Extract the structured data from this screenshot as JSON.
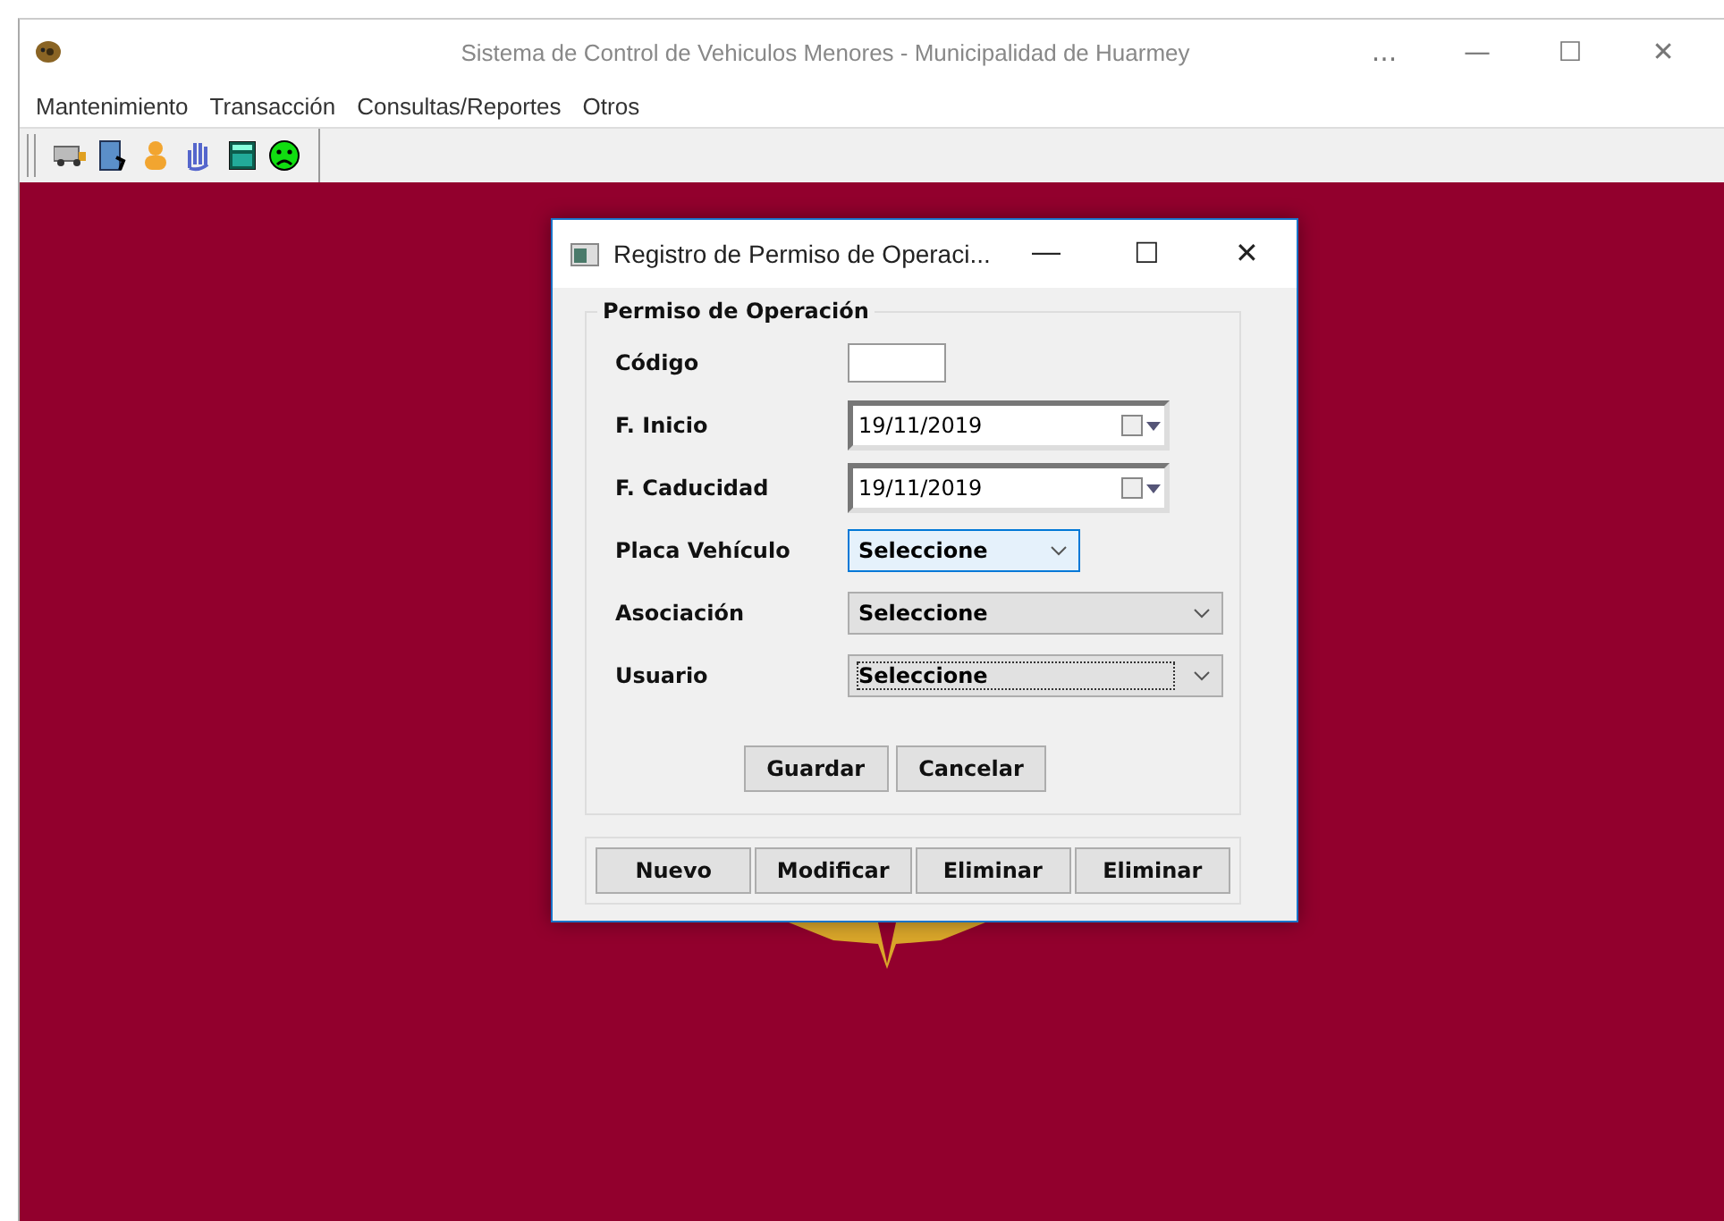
{
  "window": {
    "title": "Sistema de Control de Vehiculos Menores - Municipalidad de Huarmey",
    "controls": [
      "...",
      "—",
      "☐",
      "✕"
    ]
  },
  "menu": [
    "Mantenimiento",
    "Transacción",
    "Consultas/Reportes",
    "Otros"
  ],
  "toolbar": [
    {
      "kind": "bus"
    },
    {
      "kind": "exit"
    },
    {
      "kind": "user"
    },
    {
      "kind": "hand"
    },
    {
      "kind": "calculator"
    },
    {
      "kind": "sad"
    }
  ],
  "dialog": {
    "title": "Registro de Permiso de Operaci...",
    "controls": [
      "—",
      "☐",
      "✕"
    ],
    "group": {
      "title": "Permiso de Operación",
      "fields": [
        {
          "kind": "text",
          "label": "Código"
        },
        {
          "kind": "date",
          "label": "F. Inicio",
          "value": "19/11/2019"
        },
        {
          "kind": "date",
          "label": "F. Caducidad",
          "value": "19/11/2019"
        },
        {
          "kind": "combo",
          "label": "Placa Vehículo",
          "value": "Seleccione",
          "hovered": true,
          "focused": false,
          "wide": false
        },
        {
          "kind": "combo",
          "label": "Asociación",
          "value": "Seleccione",
          "hovered": false,
          "focused": false,
          "wide": true
        },
        {
          "kind": "combo",
          "label": "Usuario",
          "value": "Seleccione",
          "hovered": false,
          "focused": true,
          "wide": true
        }
      ],
      "buttons": [
        "Guardar",
        "Cancelar"
      ]
    },
    "actions": [
      "Nuevo",
      "Modificar",
      "Eliminar",
      "Eliminar"
    ]
  }
}
